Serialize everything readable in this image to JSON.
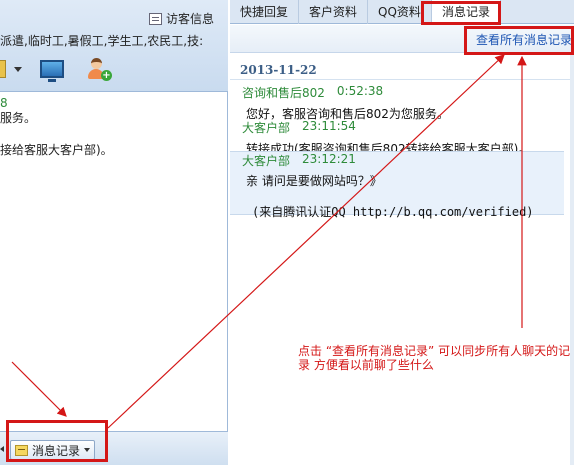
{
  "left_panel": {
    "visitor_info_label": "访客信息",
    "tags_text": "派遣,临时工,暑假工,学生工,农民工,技:",
    "messages": [
      {
        "text": "8"
      },
      {
        "text": "服务。"
      },
      {
        "text": "接给客服大客户部)。"
      }
    ],
    "message_record_button": "消息记录"
  },
  "tabs": [
    {
      "label": "快捷回复"
    },
    {
      "label": "客户资料"
    },
    {
      "label": "QQ资料"
    },
    {
      "label": "消息记录"
    }
  ],
  "toolbar": {
    "view_all_link": "查看所有消息记录"
  },
  "history": {
    "date": "2013-11-22",
    "messages": [
      {
        "sender": "咨询和售后802",
        "time": "0:52:38",
        "body": "您好，客服咨询和售后802为您服务。"
      },
      {
        "sender": "大客户部",
        "time": "23:11:54",
        "body": "转接成功(客服咨询和售后802转接给客服大客户部)。"
      },
      {
        "sender": "大客户部",
        "time": "23:12:21",
        "body": "亲  请问是要做网站吗？》",
        "verify": "(来自腾讯认证QQ http://b.qq.com/verified)"
      }
    ]
  },
  "annotation": "点击 “查看所有消息记录” 可以同步所有人聊天的记录  方便看以前聊了些什么",
  "colors": {
    "annotation_red": "#d41717",
    "link_blue": "#1d55b3",
    "sender_green": "#2e8b3a"
  }
}
